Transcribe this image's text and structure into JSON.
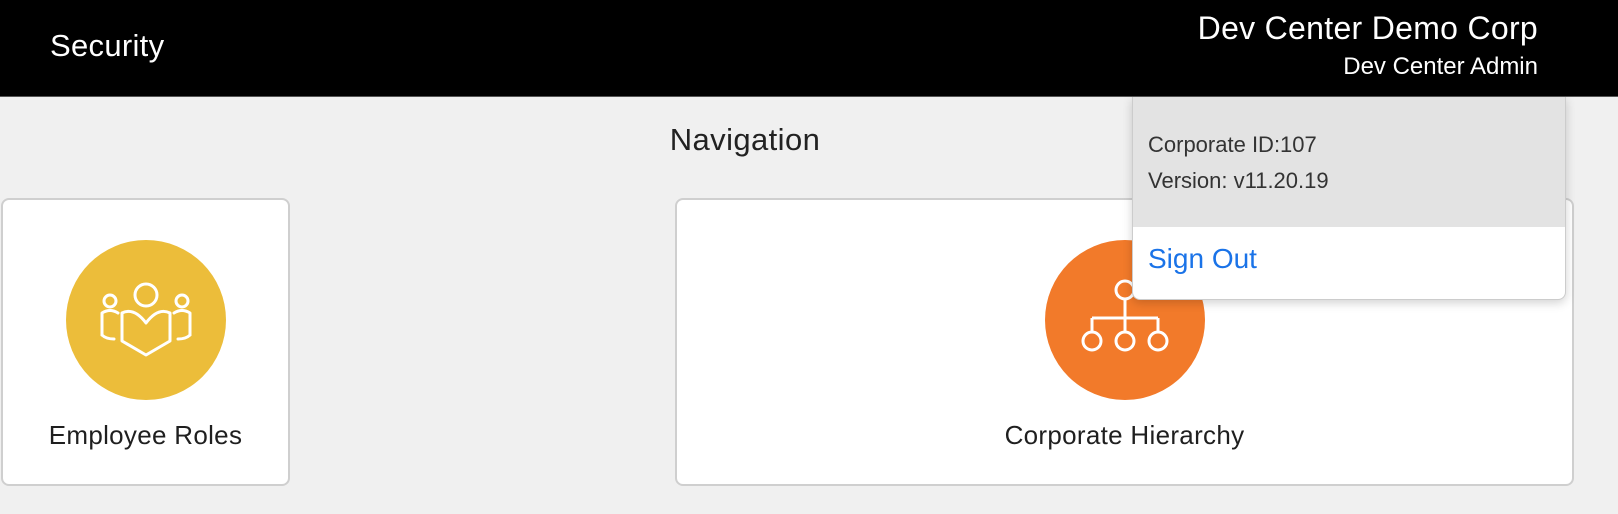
{
  "header": {
    "title": "Security",
    "account": {
      "company": "Dev Center Demo Corp",
      "role": "Dev Center Admin"
    }
  },
  "main": {
    "heading": "Navigation",
    "cards": [
      {
        "label": "Employee Roles",
        "icon": "employee-roles-icon",
        "color": "#ecbd3a"
      },
      {
        "label": "Corporate Hierarchy",
        "icon": "hierarchy-icon",
        "color": "#f27a2a"
      }
    ]
  },
  "account_menu": {
    "corporate_id": "Corporate ID:107",
    "version": "Version: v11.20.19",
    "sign_out": "Sign Out",
    "link_color": "#1a73e8"
  }
}
